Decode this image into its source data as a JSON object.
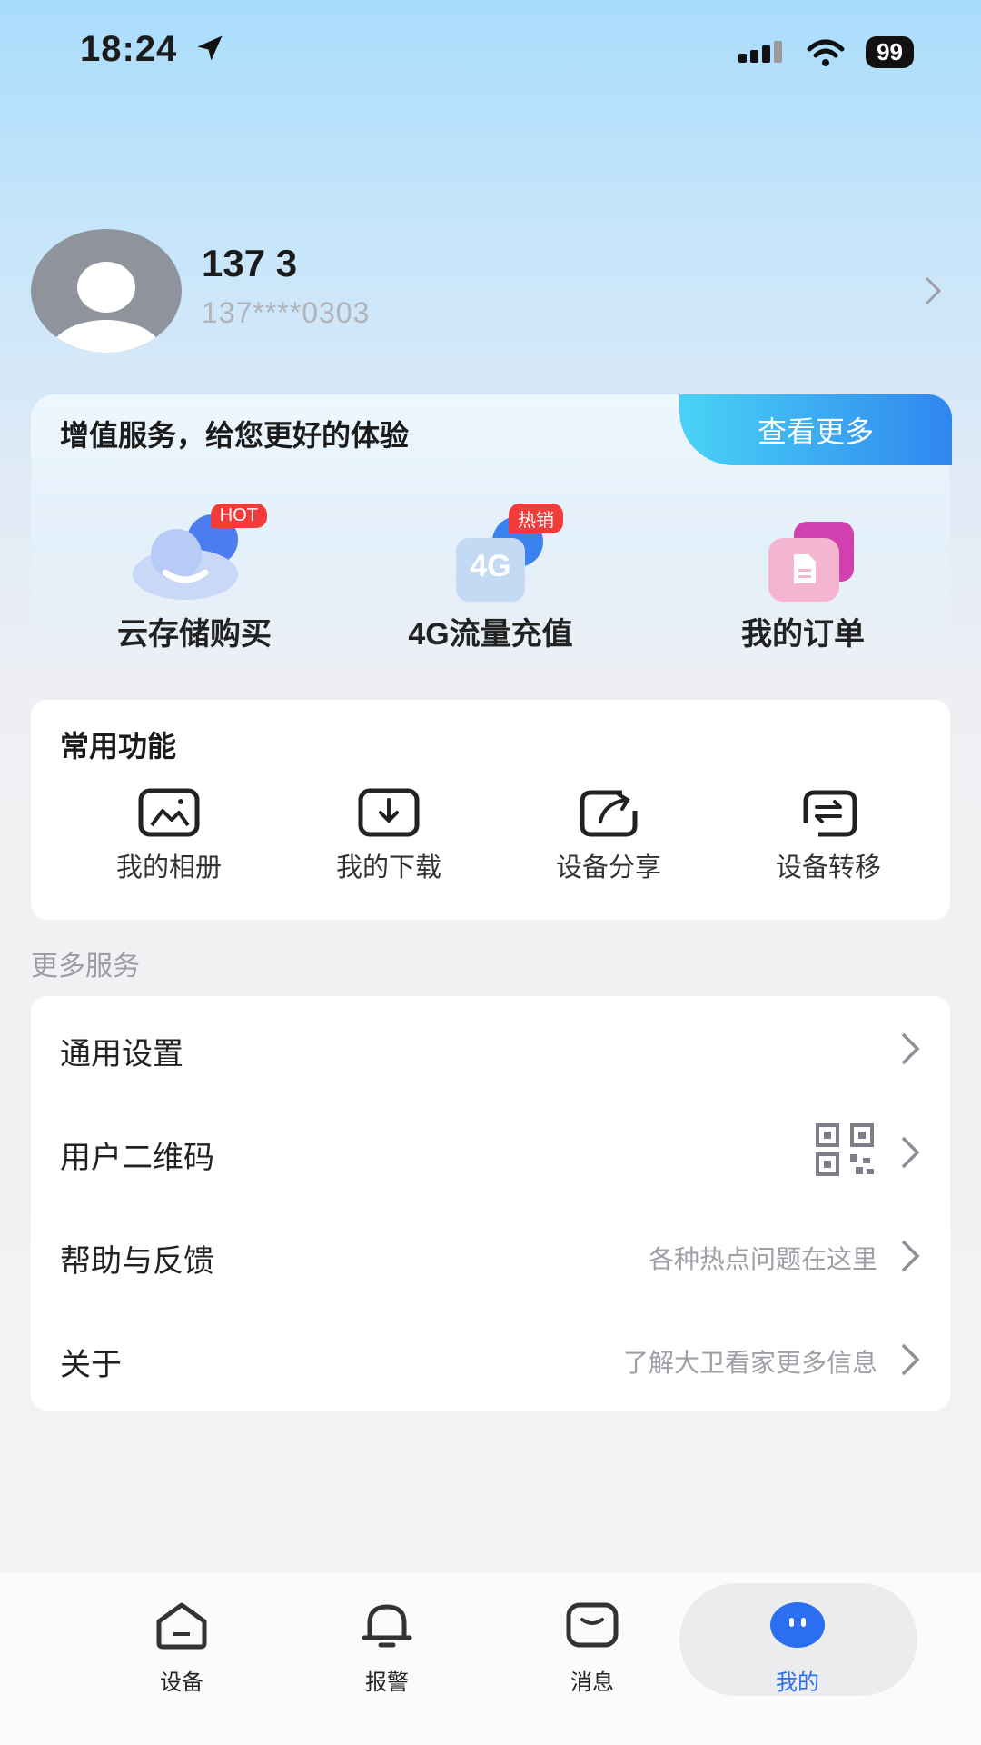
{
  "status": {
    "time": "18:24",
    "battery": "99"
  },
  "profile": {
    "name": "137 3",
    "phone": "137****0303"
  },
  "value_added": {
    "title": "增值服务，给您更好的体验",
    "more_label": "查看更多",
    "items": [
      {
        "label": "云存储购买",
        "badge": "HOT"
      },
      {
        "label": "4G流量充值",
        "badge": "热销",
        "icon_text": "4G"
      },
      {
        "label": "我的订单"
      }
    ]
  },
  "common": {
    "title": "常用功能",
    "items": [
      {
        "label": "我的相册",
        "icon": "album-icon"
      },
      {
        "label": "我的下载",
        "icon": "download-icon"
      },
      {
        "label": "设备分享",
        "icon": "share-icon"
      },
      {
        "label": "设备转移",
        "icon": "transfer-icon"
      }
    ]
  },
  "more_services": {
    "title": "更多服务",
    "items": [
      {
        "label": "通用设置",
        "hint": ""
      },
      {
        "label": "用户二维码",
        "hint": "",
        "icon": "qr-code-icon"
      },
      {
        "label": "帮助与反馈",
        "hint": "各种热点问题在这里"
      },
      {
        "label": "关于",
        "hint": "了解大卫看家更多信息"
      }
    ]
  },
  "nav": {
    "items": [
      {
        "label": "设备",
        "icon": "home-icon"
      },
      {
        "label": "报警",
        "icon": "bell-icon"
      },
      {
        "label": "消息",
        "icon": "message-icon"
      },
      {
        "label": "我的",
        "icon": "profile-icon",
        "active": true
      }
    ],
    "active_color": "#2b6ef2"
  }
}
